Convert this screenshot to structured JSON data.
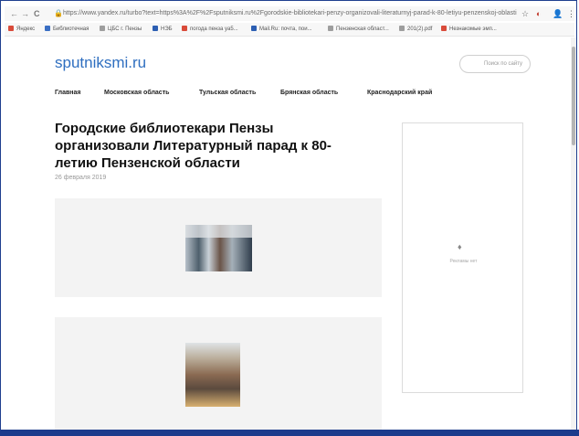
{
  "browser": {
    "nav_back": "←",
    "nav_forward": "→",
    "nav_reload": "C",
    "lock_icon": "🔒",
    "url": "https://www.yandex.ru/turbo?text=https%3A%2F%2Fsputniksmi.ru%2Fgorodskie-bibliotekari-penzy-organizovali-literaturnyj-parad-k-80-letiyu-penzenskoj-oblasti",
    "star_icon": "☆",
    "ext1_icon": "◐",
    "profile_icon": "👤",
    "menu_icon": "⋮"
  },
  "bookmarks": [
    {
      "label": "Яндекс",
      "color": "#d94b3a"
    },
    {
      "label": "Библиотечная",
      "color": "#3b6fc4"
    },
    {
      "label": "ЦБС г. Пензы",
      "color": "#9e9e9e"
    },
    {
      "label": "НЭБ",
      "color": "#2d5fb3"
    },
    {
      "label": "погода пенза ya5...",
      "color": "#d94b3a"
    },
    {
      "label": "Mail.Ru: почта, пои...",
      "color": "#2d5fb3"
    },
    {
      "label": "Пензенская област...",
      "color": "#9e9e9e"
    },
    {
      "label": "201(2).pdf",
      "color": "#9e9e9e"
    },
    {
      "label": "Незнакомые эмп...",
      "color": "#d94b3a"
    }
  ],
  "site": {
    "logo": "sputniksmi.ru",
    "search_placeholder": "Поиск по сайту",
    "nav": [
      "Главная",
      "Московская область",
      "Тульская область",
      "Брянская область",
      "Краснодарский край"
    ],
    "article_title": "Городские библиотекари Пензы организовали Литературный парад к 80-летию Пензенской области",
    "article_date": "26 февраля 2019",
    "sidebar_text": "Рекламы нет"
  }
}
